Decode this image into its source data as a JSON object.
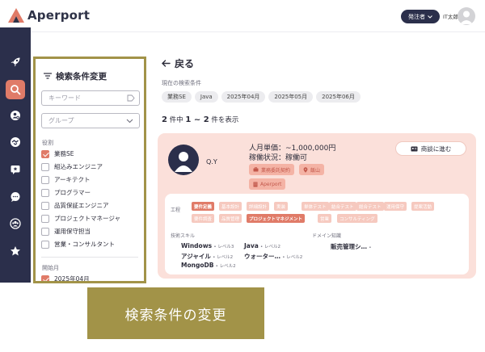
{
  "header": {
    "logo_text": "Aperport",
    "role": "発注者",
    "user_name": "IT太郎"
  },
  "nav": {
    "items": [
      "rocket-icon",
      "search-icon",
      "user-search-icon",
      "handshake-icon",
      "chat-star-icon",
      "chat-icon",
      "group-icon",
      "star-icon"
    ],
    "active_index": 1
  },
  "filter": {
    "title": "検索条件変更",
    "keyword_placeholder": "キーワード",
    "group_placeholder": "グループ",
    "role_label": "役割",
    "roles": [
      {
        "label": "業務SE",
        "checked": true
      },
      {
        "label": "組込みエンジニア",
        "checked": false
      },
      {
        "label": "アーキテクト",
        "checked": false
      },
      {
        "label": "プログラマー",
        "checked": false
      },
      {
        "label": "品質保証エンジニア",
        "checked": false
      },
      {
        "label": "プロジェクトマネージャ",
        "checked": false
      },
      {
        "label": "運用保守担当",
        "checked": false
      },
      {
        "label": "営業・コンサルタント",
        "checked": false
      }
    ],
    "start_label": "開始月",
    "start_options": [
      {
        "label": "2025年04月",
        "checked": true
      }
    ]
  },
  "caption": "検索条件の変更",
  "main": {
    "back_label": "戻る",
    "current_label": "現在の検索条件",
    "chips": [
      "業務SE",
      "Java",
      "2025年04月",
      "2025年05月",
      "2025年06月"
    ],
    "count": {
      "total": "2",
      "suffix_total": "件中",
      "range": "1 ~ 2",
      "suffix_range": "件を表示"
    }
  },
  "card": {
    "name": "Q.Y",
    "rate": "人月単価：~1,000,000円",
    "status": "稼働状況：稼働可",
    "tags": {
      "contract": "業務委託契約",
      "location": "飯山",
      "company": "Aperport"
    },
    "negotiate_label": "商談に進む",
    "process_label": "工程",
    "processes": [
      {
        "label": "要件定義",
        "on": true
      },
      {
        "label": "基本設計",
        "on": false
      },
      {
        "label": "詳細設計",
        "on": false
      },
      {
        "label": "実装",
        "on": false
      },
      {
        "label": "単体テスト",
        "on": false
      },
      {
        "label": "結合テスト",
        "on": false
      },
      {
        "label": "総合テスト",
        "on": false
      },
      {
        "label": "運用保守",
        "on": false
      },
      {
        "label": "提案活動",
        "on": false
      },
      {
        "label": "要件調査",
        "on": false
      },
      {
        "label": "品質管理",
        "on": false
      },
      {
        "label": "プロジェクトマネジメント",
        "on": true
      },
      {
        "label": "営業",
        "on": false
      },
      {
        "label": "コンサルティング",
        "on": false
      }
    ],
    "skills_label": "技術スキル",
    "domain_label": "ドメイン知識",
    "skills": [
      {
        "name": "Windows",
        "level": "レベル3"
      },
      {
        "name": "Java",
        "level": "レベル2"
      },
      {
        "name": "アジャイル",
        "level": "レベル2"
      },
      {
        "name": "ウォーター…",
        "level": "レベル2"
      },
      {
        "name": "MongoDB",
        "level": "レベル2"
      }
    ],
    "domains": [
      {
        "name": "販売管理シ…",
        "level": ""
      }
    ],
    "level_bullet": "•"
  },
  "colors": {
    "accent": "#e07b68",
    "navy": "#2b2f4b",
    "olive": "#a29348",
    "card_bg": "#fbe0da"
  }
}
